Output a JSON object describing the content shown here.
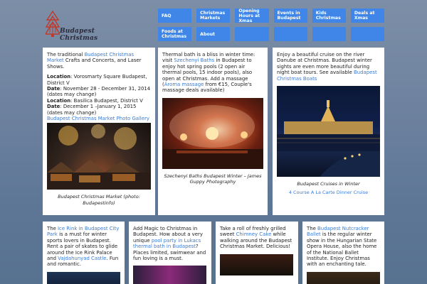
{
  "logo": {
    "line1": "Budapest",
    "line2": "Christmas"
  },
  "nav": {
    "row1": [
      "FAQ",
      "Christmas Markets",
      "Opening Hours at Xmas",
      "Events in Budapest",
      "Kids Christmas",
      "Deals at Xmas"
    ],
    "row2": [
      "Foods at Christmas",
      "About",
      "",
      "",
      "",
      ""
    ]
  },
  "card1": {
    "intro_a": "The traditional ",
    "intro_link": "Budapest Christmas Market",
    "intro_b": " Crafts and Concerts, and Laser Shows.",
    "loc1_key": "Location",
    "loc1_val": ": Vorosmarty Square Budapest, District V",
    "date1_key": "Date",
    "date1_val": ": November 28 - December  31, 2014 (dates may change)",
    "loc2_key": "Location",
    "loc2_val": ": Basilica Budapest, District V",
    "date2_key": "Date",
    "date2_val": ": December 1 –January 1, 2015 (dates may change)",
    "gallery": "Budapest Christmas Market Photo Gallery",
    "caption": "Budapest Christmas Market (photo: Budapestinfo)"
  },
  "card2": {
    "a": "Thermal bath is a bliss in winter time: visit ",
    "link1": "Szechenyi Baths",
    "b": " in Budapest to enjoy hot spring pools (2 open air thermal pools, 15 indoor pools), also open at Christmas. Add a massage (",
    "link2": "Aroma massage",
    "c": " from €15, Couple's massage deals available)",
    "caption": "Szechenyi Baths Budapest Winter – James Guppy Photography"
  },
  "card3": {
    "a": "Enjoy a beautiful cruise on the river Danube at Christmas. Budapest winter sights are even more beautiful during night boat tours. See available ",
    "link": "Budapest Christmas Boats",
    "caption": "Budapest Cruises in Winter",
    "bottom_link": "4 Course A La Carte Dinner Cruise"
  },
  "card4": {
    "a": "The ",
    "link1": "Ice Rink in Budapest City Park",
    "b": " is a must for winter sports lovers in Budapest. Rent a pair of skates to glide around the Ice Rink Palace and ",
    "link2": "Vajdahunyad Castle",
    "c": ". Fun and romantic."
  },
  "card5": {
    "a": "Add Magic to Christmas in Budapest. How about a very unique ",
    "link": "pool party in Lukacs thermal bath in Budapest",
    "b": "? Places limited, swimwear and fun loving is a must."
  },
  "card6": {
    "a": "Take a roll of freshly grilled sweet ",
    "link": "Chimney Cake",
    "b": " while walking around the Budapest Christmas Market. Delicious!"
  },
  "card7": {
    "a": "The ",
    "link": "Budapest Nutcracker Ballet",
    "b": " is the regular winter show in the Hungarian State Opera House, also the home of the National Ballet Institute. Enjoy Christmas with an enchanting tale."
  }
}
